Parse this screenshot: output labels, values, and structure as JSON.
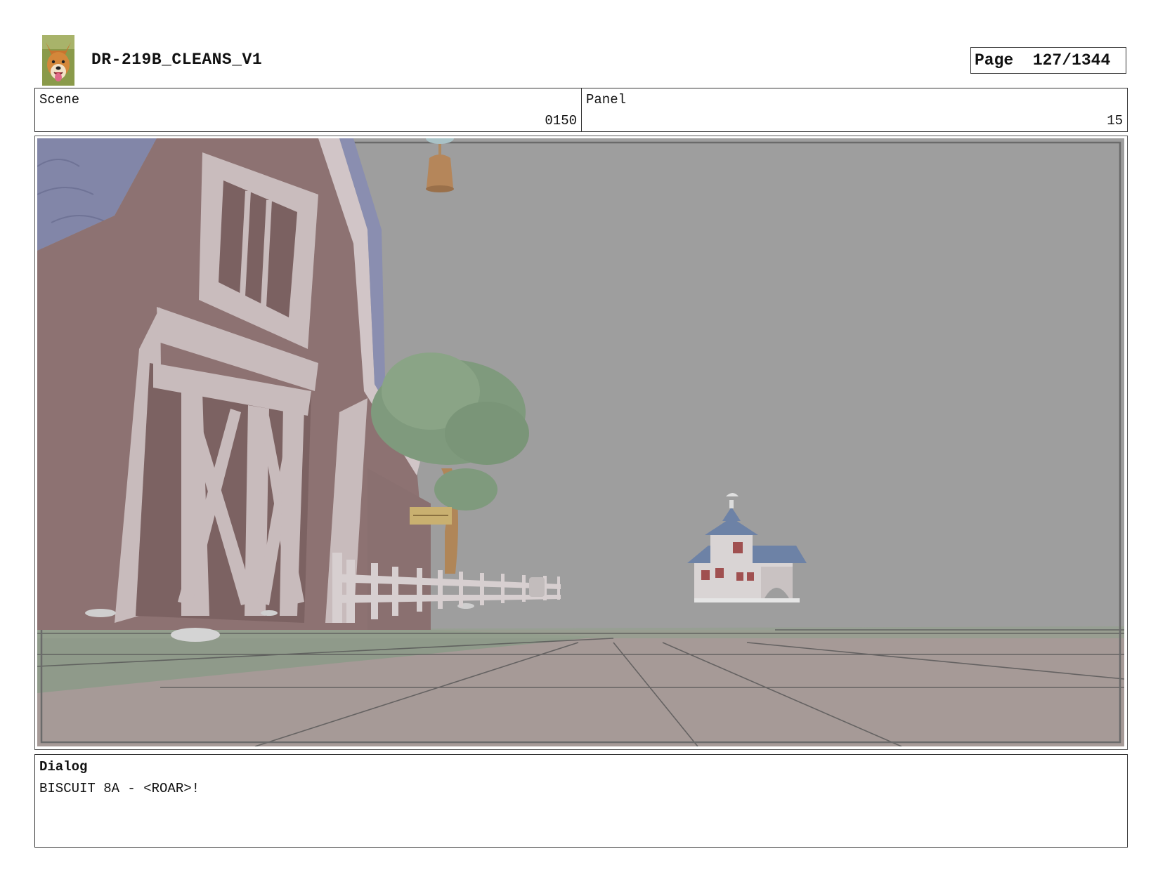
{
  "header": {
    "title": "DR-219B_CLEANS_V1",
    "page_label": "Page",
    "page_value": "127/1344"
  },
  "info": {
    "scene_label": "Scene",
    "scene_value": "0150",
    "panel_label": "Panel",
    "panel_value": "15"
  },
  "dialog": {
    "heading": "Dialog",
    "text": "BISCUIT 8A - <ROAR>!"
  }
}
